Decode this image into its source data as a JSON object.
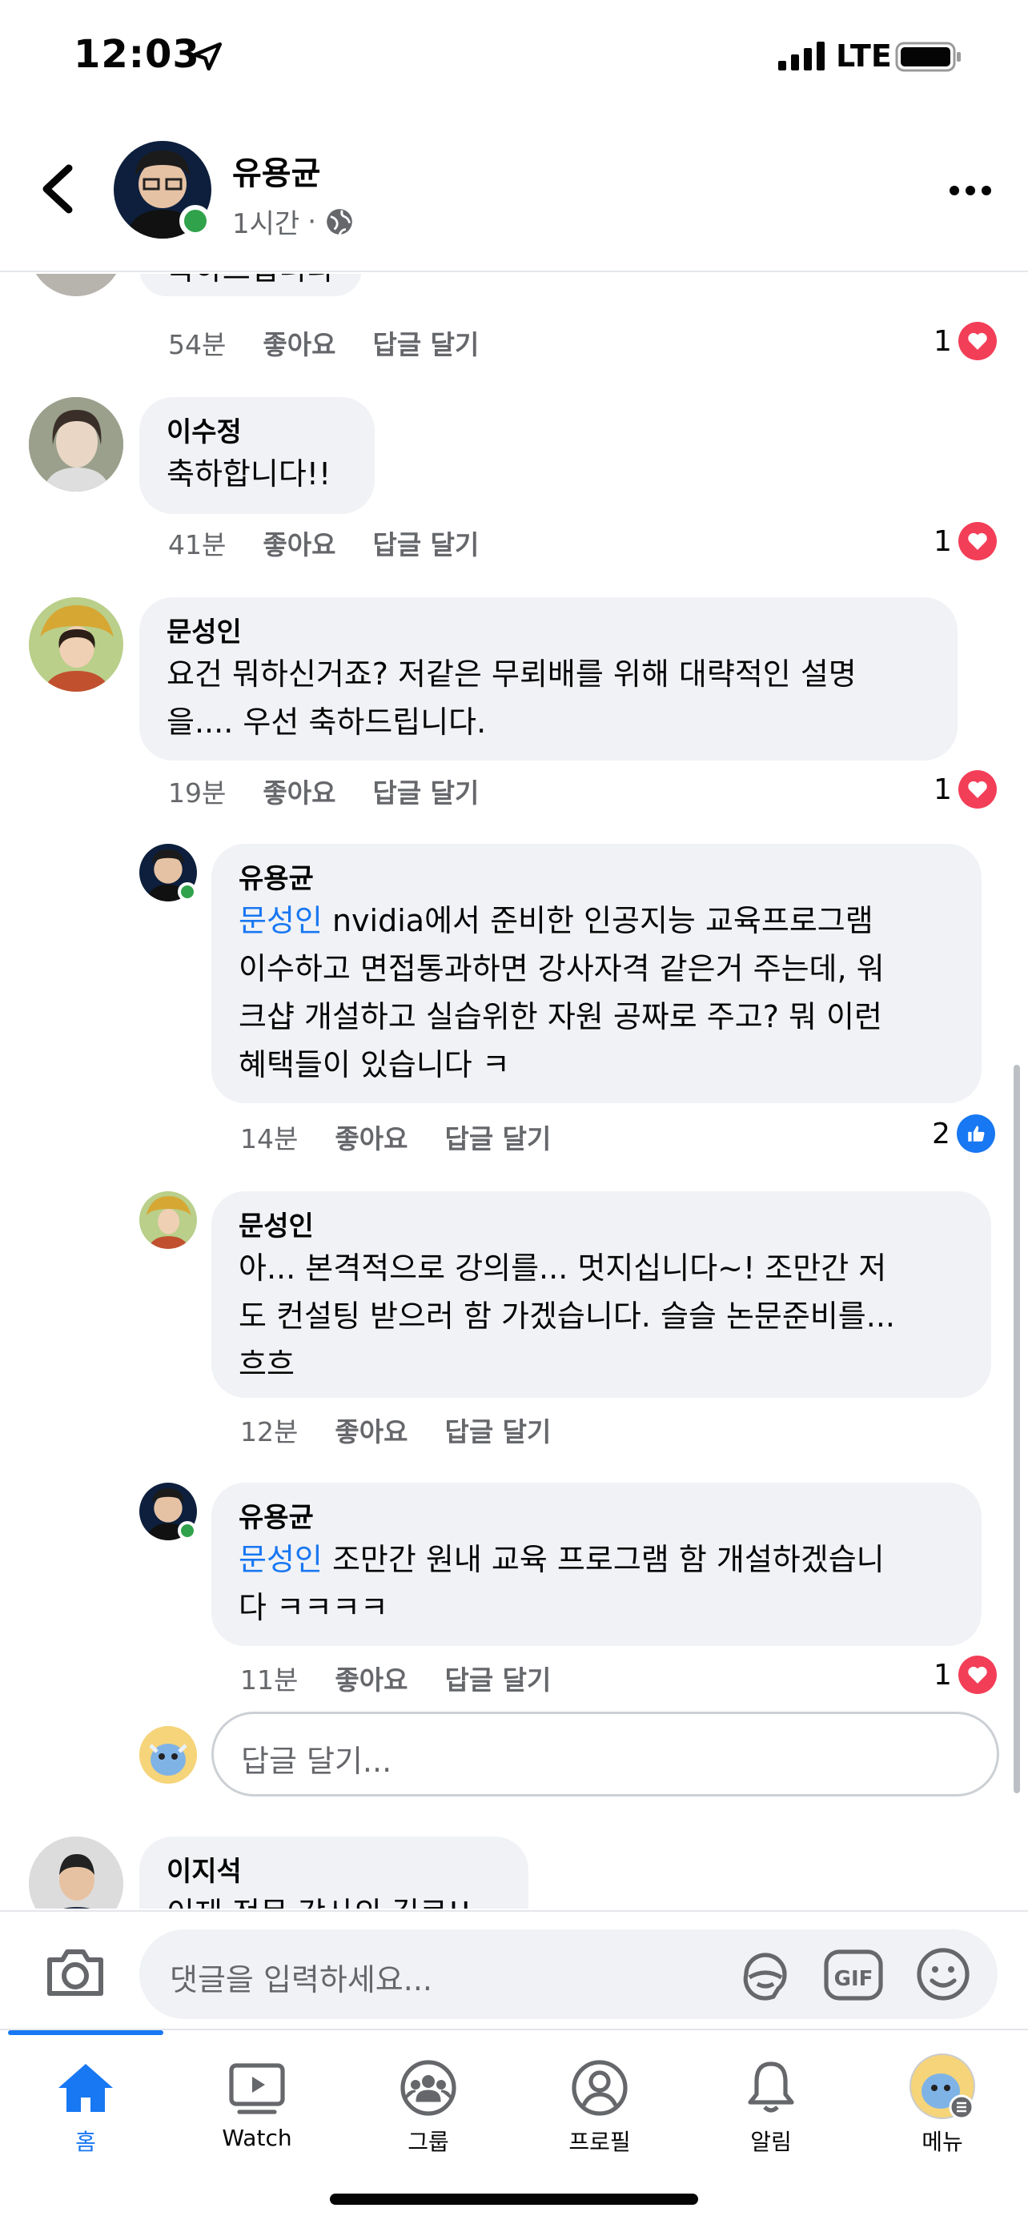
{
  "status_bar": {
    "time": "12:03",
    "network": "LTE"
  },
  "header": {
    "name": "유용균",
    "time": "1시간",
    "separator": "·"
  },
  "comments": [
    {
      "author": "",
      "text": "축하드립니다",
      "time": "54분",
      "like": "좋아요",
      "reply": "답글 달기",
      "reaction_count": "1",
      "reaction": "heart"
    },
    {
      "author": "이수정",
      "text": "축하합니다!!",
      "time": "41분",
      "like": "좋아요",
      "reply": "답글 달기",
      "reaction_count": "1",
      "reaction": "heart"
    },
    {
      "author": "문성인",
      "text_line1": "요건 뭐하신거죠? 저같은 무뢰배를 위해 대략적인 설명",
      "text_line2": "을.... 우선 축하드립니다.",
      "time": "19분",
      "like": "좋아요",
      "reply": "답글 달기",
      "reaction_count": "1",
      "reaction": "heart"
    }
  ],
  "replies": [
    {
      "author": "유용균",
      "mention": "문성인",
      "line1": " nvidia에서 준비한 인공지능 교육프로그램",
      "line2": "이수하고 면접통과하면 강사자격 같은거 주는데, 워",
      "line3": "크샵 개설하고 실습위한 자원 공짜로 주고? 뭐 이런",
      "line4": "혜택들이 있습니다 ㅋ",
      "time": "14분",
      "like": "좋아요",
      "reply": "답글 달기",
      "reaction_count": "2",
      "reaction": "like"
    },
    {
      "author": "문성인",
      "line1": "아... 본격적으로 강의를... 멋지십니다~! 조만간 저",
      "line2": "도 컨설팅 받으러 함 가겠습니다. 슬슬 논문준비를...",
      "line3": "흐흐",
      "time": "12분",
      "like": "좋아요",
      "reply": "답글 달기"
    },
    {
      "author": "유용균",
      "mention": "문성인",
      "line1": " 조만간 원내 교육 프로그램 함 개설하겠습니",
      "line2": "다 ㅋㅋㅋㅋ",
      "time": "11분",
      "like": "좋아요",
      "reply": "답글 달기",
      "reaction_count": "1",
      "reaction": "heart"
    }
  ],
  "reply_input": {
    "placeholder": "답글 달기..."
  },
  "next_comment": {
    "author": "이지석",
    "text": "이제 전문 강사의 길로!!"
  },
  "composer": {
    "placeholder": "댓글을 입력하세요..."
  },
  "tabs": [
    {
      "label": "홈",
      "icon": "home-icon",
      "active": true
    },
    {
      "label": "Watch",
      "icon": "watch-icon"
    },
    {
      "label": "그룹",
      "icon": "groups-icon"
    },
    {
      "label": "프로필",
      "icon": "profile-icon"
    },
    {
      "label": "알림",
      "icon": "bell-icon"
    },
    {
      "label": "메뉴",
      "icon": "menu-avatar-icon"
    }
  ],
  "colors": {
    "accent": "#1877f2",
    "heart": "#f33e58",
    "online": "#31a24c",
    "bubble": "#f0f2f5"
  }
}
